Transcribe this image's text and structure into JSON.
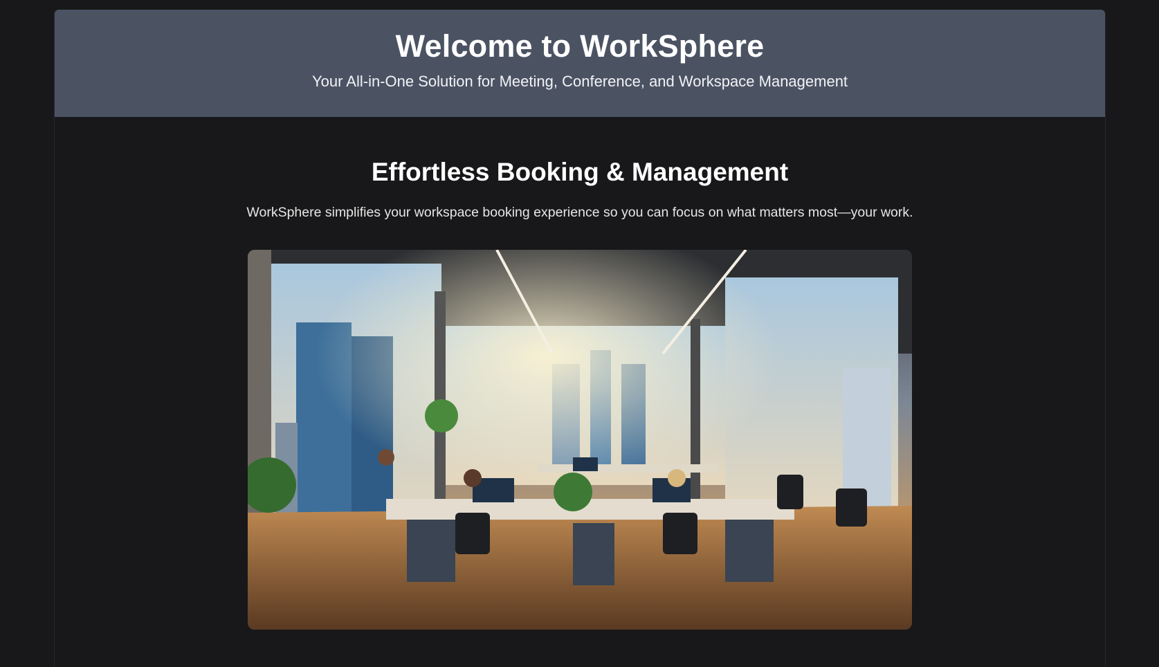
{
  "hero": {
    "title": "Welcome to WorkSphere",
    "subtitle": "Your All-in-One Solution for Meeting, Conference, and Workspace Management"
  },
  "features": {
    "title": "Effortless Booking & Management",
    "description": "WorkSphere simplifies your workspace booking experience so you can focus on what matters most—your work."
  },
  "colors": {
    "background": "#18181a",
    "hero_background": "#4b5363",
    "text_primary": "#ffffff"
  }
}
